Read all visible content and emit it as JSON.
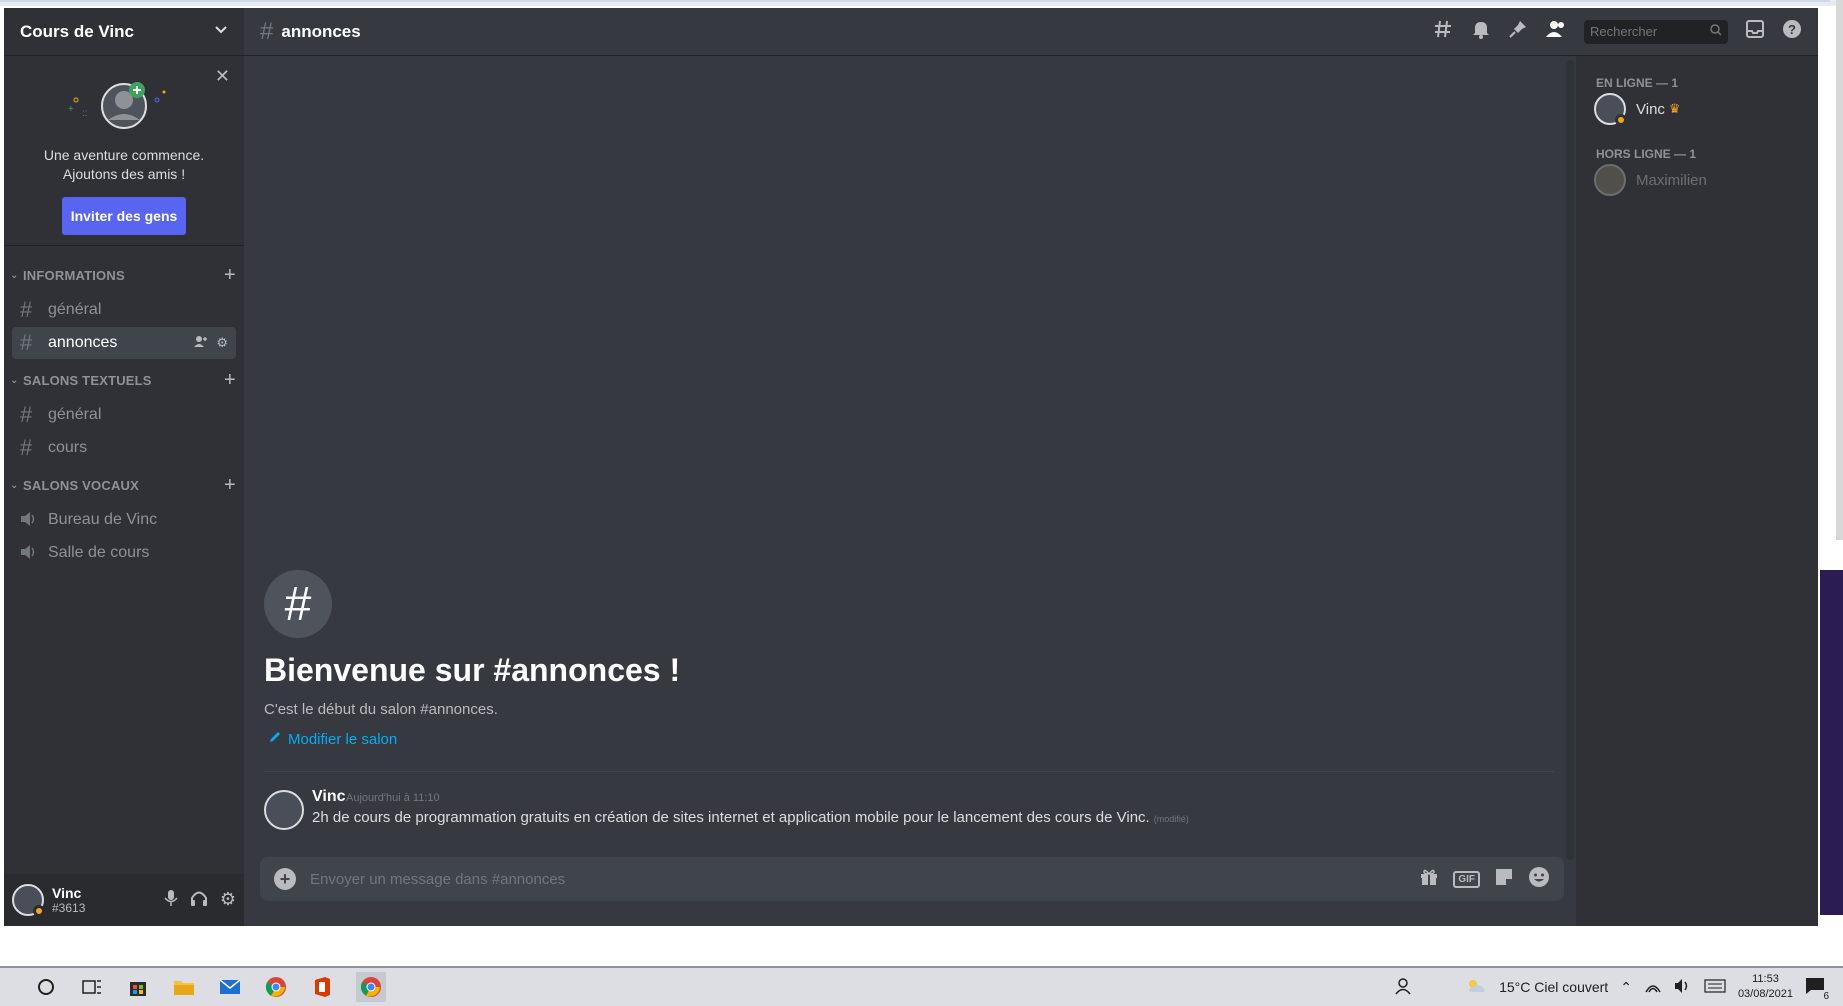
{
  "server": {
    "name": "Cours de Vinc"
  },
  "invite": {
    "text_line1": "Une aventure commence.",
    "text_line2": "Ajoutons des amis !",
    "button": "Inviter des gens"
  },
  "categories": [
    {
      "label": "INFORMATIONS",
      "channels": [
        "général",
        "annonces"
      ]
    },
    {
      "label": "SALONS TEXTUELS",
      "channels": [
        "général",
        "cours"
      ]
    },
    {
      "label": "SALONS VOCAUX",
      "channels": [
        "Bureau de Vinc",
        "Salle de cours"
      ]
    }
  ],
  "header": {
    "channel": "annonces",
    "search_placeholder": "Rechercher"
  },
  "welcome": {
    "title": "Bienvenue sur #annonces !",
    "subtitle": "C'est le début du salon #annonces.",
    "edit_link": "Modifier le salon"
  },
  "message": {
    "author": "Vinc",
    "timestamp": "Aujourd'hui à 11:10",
    "text": "2h de cours  de programmation gratuits en création de sites internet et application mobile pour le lancement des cours de Vinc.",
    "edited": "(modifié)"
  },
  "composer": {
    "placeholder": "Envoyer un message dans #annonces",
    "gif_label": "GIF"
  },
  "members": {
    "online_header": "EN LIGNE — 1",
    "offline_header": "HORS LIGNE — 1",
    "online": [
      {
        "name": "Vinc"
      }
    ],
    "offline": [
      {
        "name": "Maximilien"
      }
    ]
  },
  "user": {
    "name": "Vinc",
    "tag": "#3613"
  },
  "taskbar": {
    "weather": "15°C  Ciel couvert",
    "time": "11:53",
    "date": "03/08/2021",
    "notif_count": "6"
  },
  "colors": {
    "accent": "#5865f2",
    "link": "#00aff4",
    "idle": "#faa61a",
    "background": "#36393f",
    "sidebar": "#2f3136"
  },
  "icons": [
    "chevron-down-icon",
    "close-icon",
    "hash-icon",
    "add-member-icon",
    "gear-icon",
    "speaker-icon",
    "threads-icon",
    "bell-icon",
    "pin-icon",
    "members-icon",
    "search-icon",
    "inbox-icon",
    "help-icon",
    "pencil-icon",
    "gift-icon",
    "sticker-icon",
    "emoji-icon",
    "mic-icon",
    "headphones-icon",
    "crown-icon"
  ]
}
